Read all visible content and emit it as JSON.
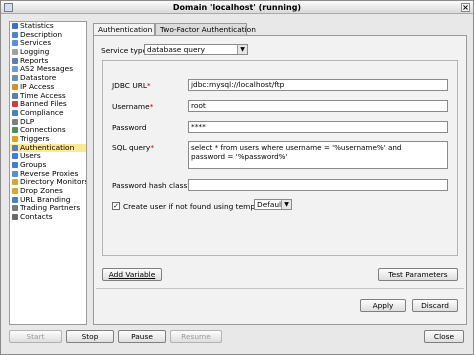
{
  "window": {
    "title": "Domain 'localhost' (running)"
  },
  "sidebar": {
    "items": [
      {
        "label": "Statistics",
        "icon": "statistics-icon",
        "color": "#3f6fbf"
      },
      {
        "label": "Description",
        "icon": "description-icon",
        "color": "#4b86c9"
      },
      {
        "label": "Services",
        "icon": "services-icon",
        "color": "#5a8fd0"
      },
      {
        "label": "Logging",
        "icon": "logging-icon",
        "color": "#a0a0a0"
      },
      {
        "label": "Reports",
        "icon": "reports-icon",
        "color": "#5a7fb5"
      },
      {
        "label": "AS2 Messages",
        "icon": "as2-messages-icon",
        "color": "#6d9ad8"
      },
      {
        "label": "Datastore",
        "icon": "datastore-icon",
        "color": "#6a8fb9"
      },
      {
        "label": "IP Access",
        "icon": "ip-access-icon",
        "color": "#e08a2e"
      },
      {
        "label": "Time Access",
        "icon": "time-access-icon",
        "color": "#5f7fa8"
      },
      {
        "label": "Banned Files",
        "icon": "banned-files-icon",
        "color": "#d43c3c"
      },
      {
        "label": "Compliance",
        "icon": "compliance-icon",
        "color": "#4b80c0"
      },
      {
        "label": "DLP",
        "icon": "dlp-icon",
        "color": "#808080"
      },
      {
        "label": "Connections",
        "icon": "connections-icon",
        "color": "#4f8f4f"
      },
      {
        "label": "Triggers",
        "icon": "triggers-icon",
        "color": "#e0a020"
      },
      {
        "label": "Authentication",
        "icon": "authentication-icon",
        "color": "#5a7fb5",
        "selected": true
      },
      {
        "label": "Users",
        "icon": "users-icon",
        "color": "#3d7fd6"
      },
      {
        "label": "Groups",
        "icon": "groups-icon",
        "color": "#3d7fd6"
      },
      {
        "label": "Reverse Proxies",
        "icon": "reverse-proxies-icon",
        "color": "#5b8fcf"
      },
      {
        "label": "Directory Monitors",
        "icon": "directory-monitors-icon",
        "color": "#d9a43a"
      },
      {
        "label": "Drop Zones",
        "icon": "drop-zones-icon",
        "color": "#d9a43a"
      },
      {
        "label": "URL Branding",
        "icon": "url-branding-icon",
        "color": "#4a7fc4"
      },
      {
        "label": "Trading Partners",
        "icon": "trading-partners-icon",
        "color": "#7a7a7a"
      },
      {
        "label": "Contacts",
        "icon": "contacts-icon",
        "color": "#6a6a6a"
      }
    ]
  },
  "tabs": [
    {
      "label": "Authentication",
      "active": true
    },
    {
      "label": "Two-Factor Authentication",
      "active": false
    }
  ],
  "form": {
    "service_type_label": "Service type",
    "service_type_value": "database query",
    "jdbc_url_label": "JDBC URL",
    "jdbc_url_value": "jdbc:mysql://localhost/ftp",
    "username_label": "Username",
    "username_value": "root",
    "password_label": "Password",
    "password_value": "****",
    "sql_query_label": "SQL query",
    "sql_query_line1": "select * from users where username = '%username%' and",
    "sql_query_line2": "password = '%password%'",
    "password_hash_class_label": "Password hash class",
    "password_hash_class_value": "",
    "required_marker": "*",
    "create_user_label": "Create user if not found using template",
    "create_user_checked": "✓",
    "template_value": "Default",
    "add_variable_label": "Add Variable",
    "test_parameters_label": "Test Parameters"
  },
  "panel_buttons": {
    "apply": "Apply",
    "discard": "Discard"
  },
  "bottom_buttons": {
    "start": "Start",
    "stop": "Stop",
    "pause": "Pause",
    "resume": "Resume",
    "close": "Close"
  },
  "glyphs": {
    "dropdown_arrow": "▼",
    "close_x": "×"
  }
}
